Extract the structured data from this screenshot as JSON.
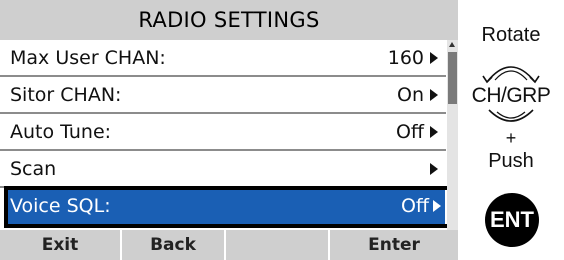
{
  "screen": {
    "title": "RADIO SETTINGS",
    "menu": [
      {
        "label": "Max User CHAN:",
        "value": "160"
      },
      {
        "label": "Sitor CHAN:",
        "value": "On"
      },
      {
        "label": "Auto Tune:",
        "value": "Off"
      },
      {
        "label": "Scan",
        "value": ""
      },
      {
        "label": "Voice SQL:",
        "value": "Off",
        "selected": true
      }
    ],
    "softkeys": [
      "Exit",
      "Back",
      "",
      "Enter"
    ]
  },
  "instructions": {
    "rotate": "Rotate",
    "dial_label": "CH/GRP",
    "plus": "+",
    "push": "Push",
    "button_label": "ENT"
  },
  "colors": {
    "title_bar": "#cfcfcf",
    "selected_row": "#1a5fb4",
    "softkey_bar": "#cfcfcf",
    "ent_button": "#000000"
  },
  "icons": [
    "arrow-right-icon",
    "scroll-up-icon",
    "rotate-dial-icon"
  ]
}
